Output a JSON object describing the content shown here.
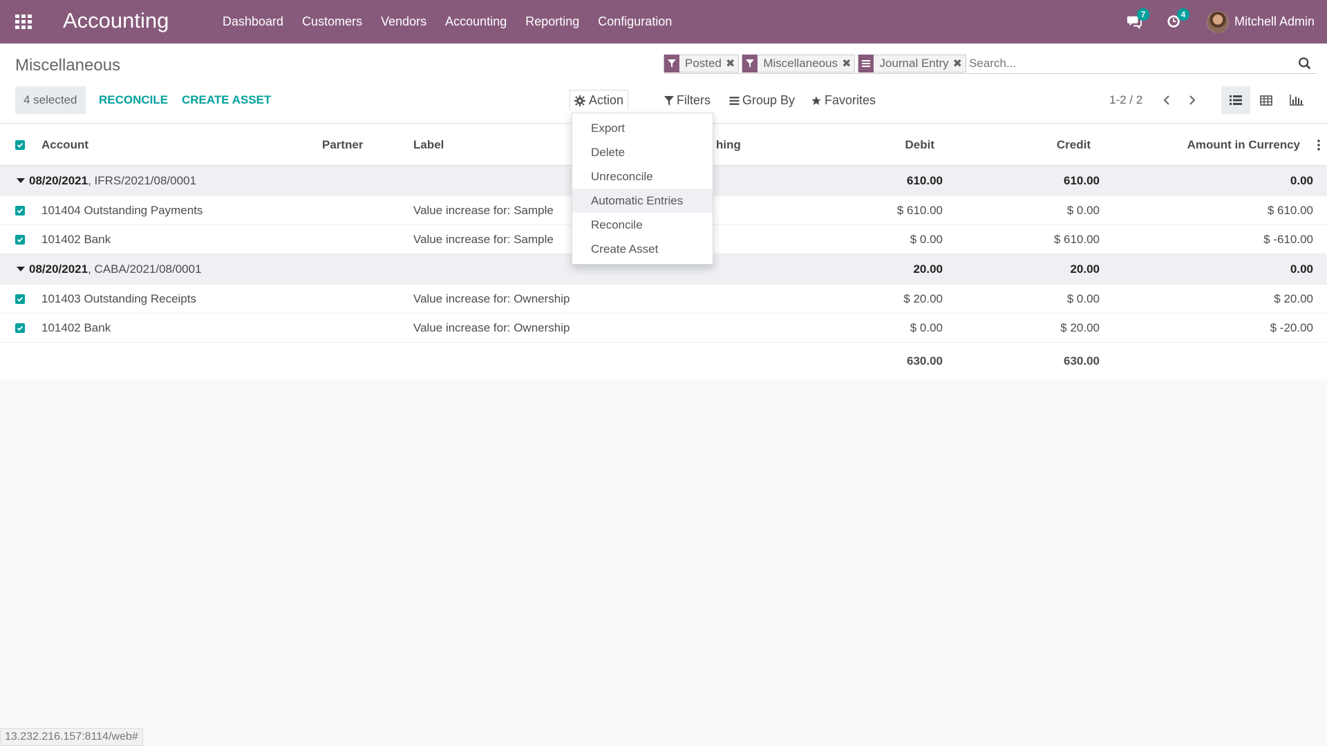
{
  "navbar": {
    "app_title": "Accounting",
    "menu": [
      "Dashboard",
      "Customers",
      "Vendors",
      "Accounting",
      "Reporting",
      "Configuration"
    ],
    "messages_count": "7",
    "activities_count": "4",
    "user_name": "Mitchell Admin"
  },
  "control_panel": {
    "breadcrumb": "Miscellaneous",
    "facets": [
      {
        "label": "Posted",
        "icon": "filter-icon"
      },
      {
        "label": "Miscellaneous",
        "icon": "filter-icon"
      },
      {
        "label": "Journal Entry",
        "icon": "group-by-icon"
      }
    ],
    "search_placeholder": "Search...",
    "selected_label": "4 selected",
    "reconcile_label": "RECONCILE",
    "create_asset_label": "CREATE ASSET",
    "action_label": "Action",
    "filters_label": "Filters",
    "group_by_label": "Group By",
    "favorites_label": "Favorites",
    "pager": "1-2 / 2"
  },
  "action_menu": {
    "items": [
      "Export",
      "Delete",
      "Unreconcile",
      "Automatic Entries",
      "Reconcile",
      "Create Asset"
    ],
    "highlighted": "Automatic Entries"
  },
  "table": {
    "columns": {
      "account": "Account",
      "partner": "Partner",
      "label": "Label",
      "matching_partial": "hing",
      "debit": "Debit",
      "credit": "Credit",
      "amount_currency": "Amount in Currency"
    },
    "groups": [
      {
        "date": "08/20/2021",
        "ref": ", IFRS/2021/08/0001",
        "debit": "610.00",
        "credit": "610.00",
        "amount": "0.00",
        "rows": [
          {
            "account": "101404 Outstanding Payments",
            "label": "Value increase for: Sample",
            "debit": "$ 610.00",
            "credit": "$ 0.00",
            "amount": "$ 610.00"
          },
          {
            "account": "101402 Bank",
            "label": "Value increase for: Sample",
            "debit": "$ 0.00",
            "credit": "$ 610.00",
            "amount": "$ -610.00"
          }
        ]
      },
      {
        "date": "08/20/2021",
        "ref": ", CABA/2021/08/0001",
        "debit": "20.00",
        "credit": "20.00",
        "amount": "0.00",
        "rows": [
          {
            "account": "101403 Outstanding Receipts",
            "label": "Value increase for: Ownership",
            "debit": "$ 20.00",
            "credit": "$ 0.00",
            "amount": "$ 20.00"
          },
          {
            "account": "101402 Bank",
            "label": "Value increase for: Ownership",
            "debit": "$ 0.00",
            "credit": "$ 20.00",
            "amount": "$ -20.00"
          }
        ]
      }
    ],
    "totals": {
      "debit": "630.00",
      "credit": "630.00"
    }
  },
  "status_url": "13.232.216.157:8114/web#",
  "colors": {
    "brand": "#875a7b",
    "accent": "#00a09d"
  }
}
